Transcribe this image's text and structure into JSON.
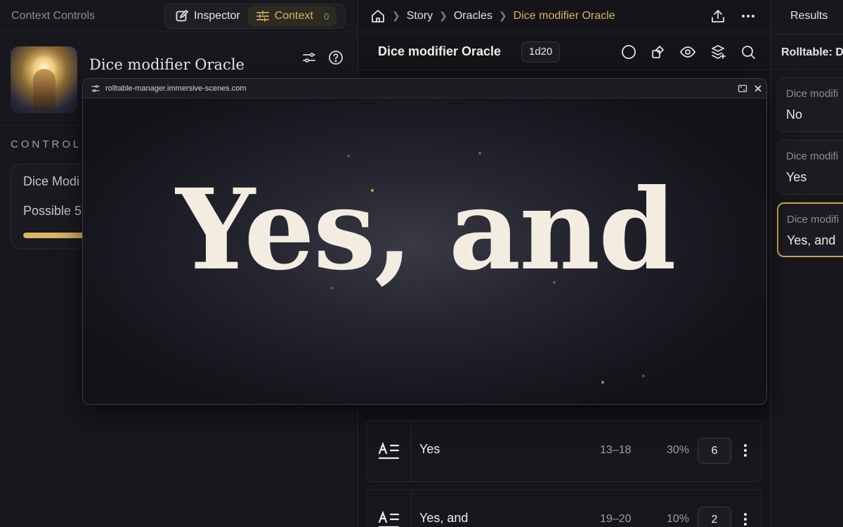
{
  "left": {
    "header_title": "Context Controls",
    "tabs": [
      {
        "label": "Inspector",
        "icon": "edit-icon",
        "active": false
      },
      {
        "label": "Context",
        "icon": "sliders-icon",
        "active": true,
        "count": "0"
      }
    ],
    "oracle_title": "Dice modifier Oracle",
    "controls_label": "CONTROLS",
    "control": {
      "name": "Dice Modi",
      "sub": "Possible 5",
      "progress": 1.0
    }
  },
  "breadcrumb": {
    "items": [
      "Story",
      "Oracles",
      "Dice modifier Oracle"
    ],
    "home_icon": "home-icon"
  },
  "oracle_bar": {
    "name": "Dice modifier Oracle",
    "dice": "1d20"
  },
  "rows": [
    {
      "label": "Yes",
      "range": "13–18",
      "pct": "30%",
      "weight": "6",
      "icon": "text-align-icon"
    },
    {
      "label": "Yes, and",
      "range": "19–20",
      "pct": "10%",
      "weight": "2",
      "icon": "text-align-icon"
    }
  ],
  "right": {
    "title": "Results",
    "rolltable_label": "Rolltable: Di",
    "results": [
      {
        "title": "Dice modifi",
        "value": "No"
      },
      {
        "title": "Dice modifi",
        "value": "Yes"
      },
      {
        "title": "Dice modifi",
        "value": "Yes, and",
        "selected": true
      }
    ]
  },
  "popup": {
    "url": "rolltable-manager.immersive-scenes.com",
    "big_text": "Yes, and"
  },
  "colors": {
    "accent": "#d8b261",
    "background": "#15151b",
    "text": "#e6e4df"
  }
}
